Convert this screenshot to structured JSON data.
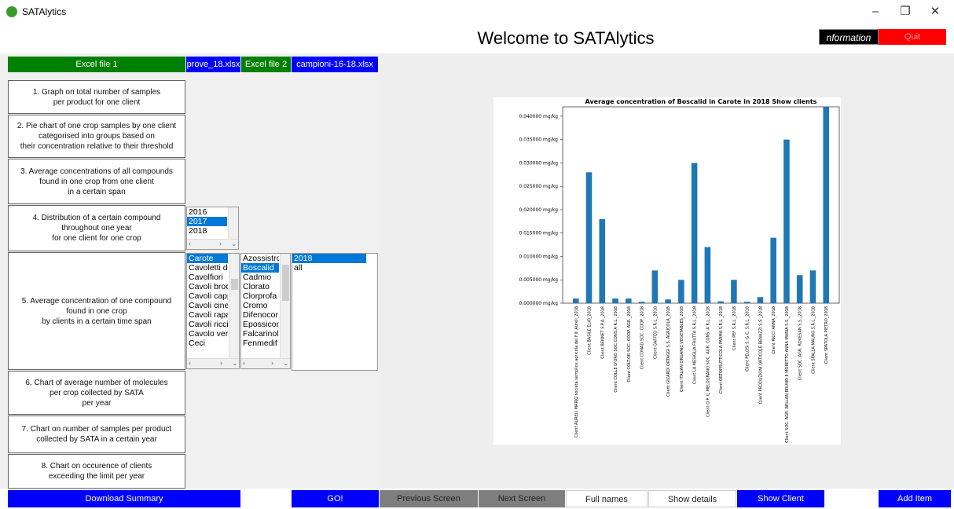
{
  "window": {
    "title": "SATAlytics",
    "minimize": "–",
    "restore": "❐",
    "close": "✕"
  },
  "header": {
    "welcome": "Welcome to SATAlytics",
    "information": "nformation",
    "quit": "Quit"
  },
  "files": {
    "excel1_label": "Excel file 1",
    "excel1_name": "prove_18.xlsx",
    "excel2_label": "Excel file 2",
    "excel2_name": "campioni-16-18.xlsx"
  },
  "functions": [
    "1. Graph on total number of samples\nper product for one client",
    "2. Pie chart of one crop samples by one client\ncategorised into groups based on\ntheir concentration relative to their threshold",
    "3. Average concentrations of all compounds\nfound in one crop from one client\nin a certain span",
    "4. Distribution of a certain compound\nthroughout one year\nfor one client for one crop",
    "5. Average concentration of one compound\nfound in one crop\nby clients in a certain time span",
    "6. Chart of average number of molecules\nper crop collected by SATA\nper year",
    "7. Chart on number of samples per product\ncollected by SATA in a certain year",
    "8. Chart on occurence of clients\nexceeding the limit per year"
  ],
  "years_list": {
    "items": [
      "2016",
      "2017",
      "2018"
    ],
    "selected": "2017"
  },
  "crops_list": {
    "items": [
      "Carote",
      "Cavoletti di",
      "Cavolfiori",
      "Cavoli broc",
      "Cavoli capp",
      "Cavoli cine",
      "Cavoli rapa",
      "Cavoli ricci",
      "Cavolo verz",
      "Ceci"
    ],
    "selected": "Carote"
  },
  "compounds_list": {
    "items": [
      "Azossistro",
      "Boscalid",
      "Cadmio",
      "Clorato",
      "Clorprofa",
      "Cromo",
      "Difenocor",
      "Epossicon",
      "Falcarinol",
      "Fenmedif"
    ],
    "selected": "Boscalid"
  },
  "span_list": {
    "items": [
      "2018",
      "all"
    ],
    "selected": "2018"
  },
  "bottom": {
    "download": "Download Summary",
    "go": "GO!",
    "previous": "Previous Screen",
    "next": "Next Screen",
    "full_names": "Full names",
    "show_details": "Show details",
    "show_client": "Show Client",
    "add_item": "Add Item"
  },
  "colors": {
    "bar": "#1f77b4",
    "green": "#008000",
    "blue": "#0000ff",
    "red": "#ff0000"
  },
  "chart_data": {
    "type": "bar",
    "title": "Average concentration of Boscalid in Carote in 2018 Show clients",
    "ylim": [
      0,
      0.042
    ],
    "yticks": [
      "0.000000 mg/kg",
      "0.005000 mg/kg",
      "0.010000 mg/kg",
      "0.015000 mg/kg",
      "0.020000 mg/kg",
      "0.025000 mg/kg",
      "0.030000 mg/kg",
      "0.035000 mg/kg",
      "0.040000 mg/kg"
    ],
    "ytick_values": [
      0,
      0.005,
      0.01,
      0.015,
      0.02,
      0.025,
      0.03,
      0.035,
      0.04
    ],
    "categories": [
      "Client AURELI MARIO società semplice agricola dei F.lli Aureli_2018",
      "Client BASILE ELIO_2018",
      "Client BENNET S.P.A._2018",
      "Client COLLE D'ORO SOC.CONS.A R.L._2018",
      "Client COLT.OR SOC. COOP. AGR._2018",
      "Client CONAD SOC. COOP._2018",
      "Client GAFFEO S.R.L._2018",
      "Client GICARDI ORTAGGI S.S. AGRICOLA_2018",
      "Client ITALIAN ORGANIC VEGETABLES_2018",
      "Client LA MESIGLIA FRUTTA S.R.L._2018",
      "Client O.P. IL MELOGRANO SOC. AGR. CONS. A R.L._2018",
      "Client ORTOFRUTTICOLA PARMA S.R.L._2018",
      "Client PEF S.R.L._2018",
      "Client PELOSI S. & C. S.R.L._2018",
      "Client PRODUZIONI ORTICOLE BENAZZI S.S._2018",
      "Client RICCI ANNA_2018",
      "Client SOC. AGR. BELLAN BRUNO E MORETTO ANNA MARIA S.S._2018",
      "Client SOC. AGR. ROVESAN S.S._2018",
      "Client SPALLA MAURO S.R.L._2018",
      "Client SPATOLA PIETRO_2018"
    ],
    "values": [
      0.001,
      0.028,
      0.018,
      0.001,
      0.001,
      0.0003,
      0.007,
      0.0008,
      0.005,
      0.03,
      0.012,
      0.0004,
      0.005,
      0.0003,
      0.0013,
      0.014,
      0.035,
      0.006,
      0.007,
      0.042
    ]
  }
}
